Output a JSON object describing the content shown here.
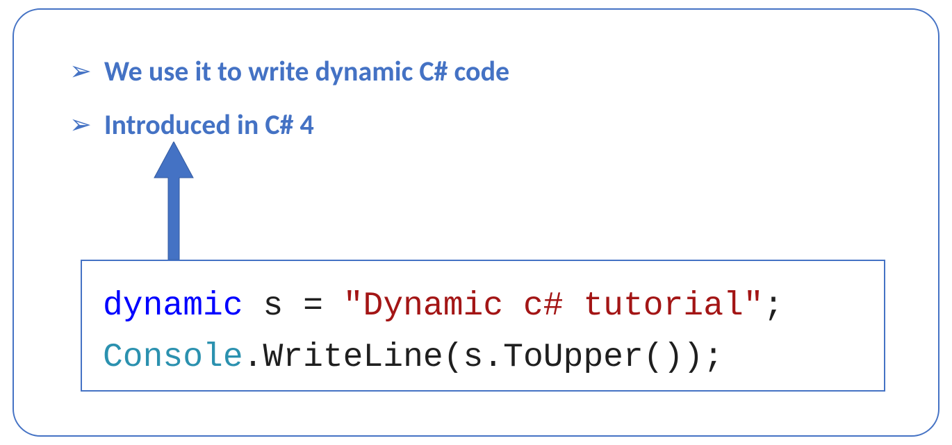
{
  "bullets": [
    {
      "text": "We use it to write dynamic C# code"
    },
    {
      "text": "Introduced in C# 4"
    }
  ],
  "code": {
    "keyword_dynamic": "dynamic",
    "var_s": "s",
    "assign": "=",
    "string_literal": "\"Dynamic c# tutorial\"",
    "semicolon": ";",
    "type_console": "Console",
    "dot1": ".",
    "method_writeline": "WriteLine",
    "paren_open": "(",
    "var_s2": "s",
    "dot2": ".",
    "method_toupper": "ToUpper",
    "paren_pair": "()",
    "paren_close": ")",
    "semicolon2": ";"
  }
}
